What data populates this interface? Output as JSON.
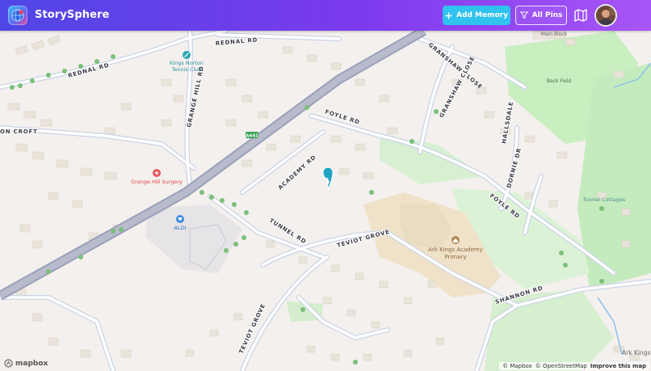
{
  "app": {
    "title": "StorySphere"
  },
  "toolbar": {
    "add_memory_label": "Add Memory",
    "all_pins_label": "All Pins",
    "map_toggle_icon": "map-icon"
  },
  "colors": {
    "header_start": "#4f46e5",
    "header_end": "#a855f7",
    "accent": "#2fc3ee",
    "pin": "#22a3c4"
  },
  "map": {
    "roads": {
      "rednal_1": "REDNAL RD",
      "rednal_2": "REDNAL RD",
      "grange_hill": "GRANGE HILL RD",
      "foyle_1": "FOYLE RD",
      "foyle_2": "FOYLE RD",
      "academy": "ACADEMY RD",
      "tunnel": "TUNNEL RD",
      "teviot_1": "TEVIOT GROVE",
      "teviot_2": "TEVIOT GROVE",
      "shannon": "SHANNON RD",
      "granshaw": "GRANSHAW CLOSE",
      "granshaw_2": "GRANSHAW CLOSE",
      "hallsdale": "HALLSDALE",
      "dornie": "DORNIE DR",
      "croft": "ON CROFT",
      "shield": "A441"
    },
    "pois": {
      "tennis_1": "Kings Norton",
      "tennis_2": "Tennis Club",
      "surgery": "Grange Hill Surgery",
      "aldi": "ALDI",
      "academy_1": "Ark Kings Academy",
      "academy_2": "Primary",
      "back_field": "Back Field",
      "tunnel_cottages": "Tunnel Cottages",
      "main_block": "Main Block",
      "ark_kings": "Ark Kings"
    }
  },
  "branding": {
    "mapbox": "mapbox"
  },
  "attribution": {
    "mapbox": "© Mapbox",
    "osm": "© OpenStreetMap",
    "improve": "Improve this map"
  }
}
